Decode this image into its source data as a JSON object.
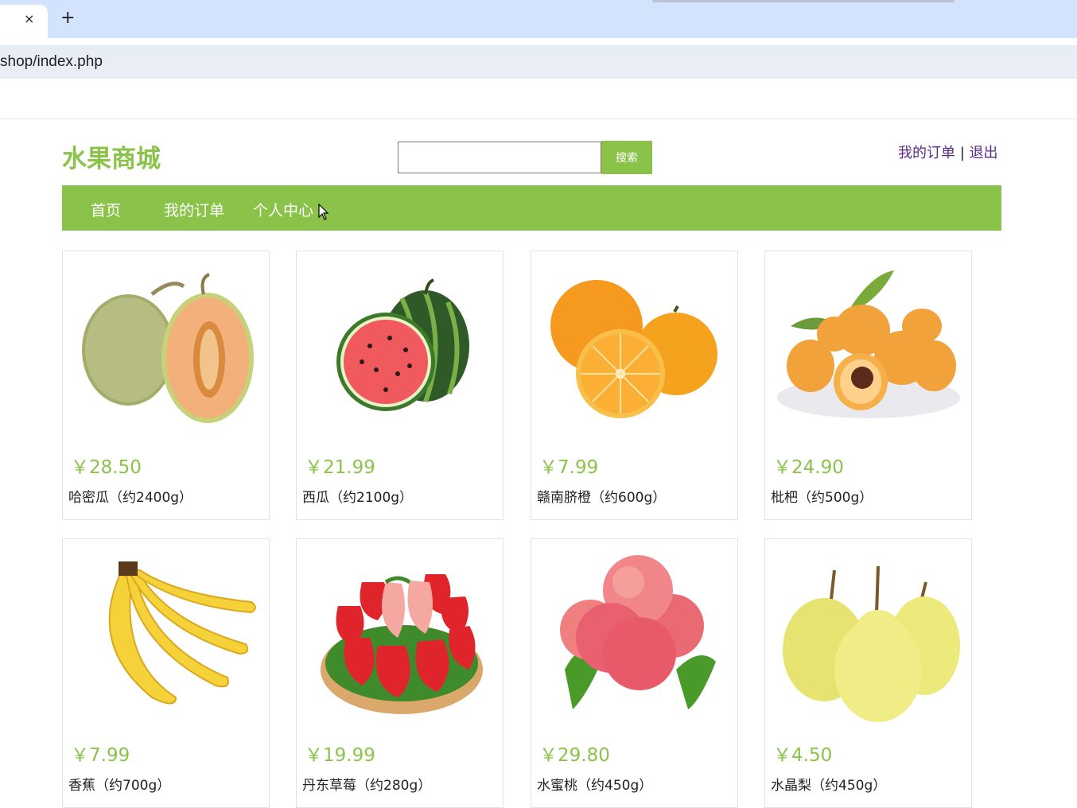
{
  "browser": {
    "tab_close": "×",
    "new_tab": "+",
    "url": "shop/index.php"
  },
  "header": {
    "logo": "水果商城",
    "search_placeholder": "",
    "search_label": "搜索",
    "links": {
      "orders": "我的订单",
      "separator": "|",
      "logout": "退出"
    }
  },
  "nav": {
    "items": [
      "首页",
      "我的订单",
      "个人中心"
    ]
  },
  "products": [
    {
      "price": "￥28.50",
      "name": "哈密瓜（约2400g）",
      "icon": "cantaloupe-image"
    },
    {
      "price": "￥21.99",
      "name": "西瓜（约2100g）",
      "icon": "watermelon-image"
    },
    {
      "price": "￥7.99",
      "name": "赣南脐橙（约600g）",
      "icon": "orange-image"
    },
    {
      "price": "￥24.90",
      "name": "枇杷（约500g）",
      "icon": "loquat-image"
    },
    {
      "price": "￥7.99",
      "name": "香蕉（约700g）",
      "icon": "banana-image"
    },
    {
      "price": "￥19.99",
      "name": "丹东草莓（约280g）",
      "icon": "strawberry-image"
    },
    {
      "price": "￥29.80",
      "name": "水蜜桃（约450g）",
      "icon": "peach-image"
    },
    {
      "price": "￥4.50",
      "name": "水晶梨（约450g）",
      "icon": "pear-image"
    }
  ],
  "colors": {
    "brand": "#8bc34a",
    "link": "#5b2a86",
    "tabbar": "#d3e3fd"
  }
}
